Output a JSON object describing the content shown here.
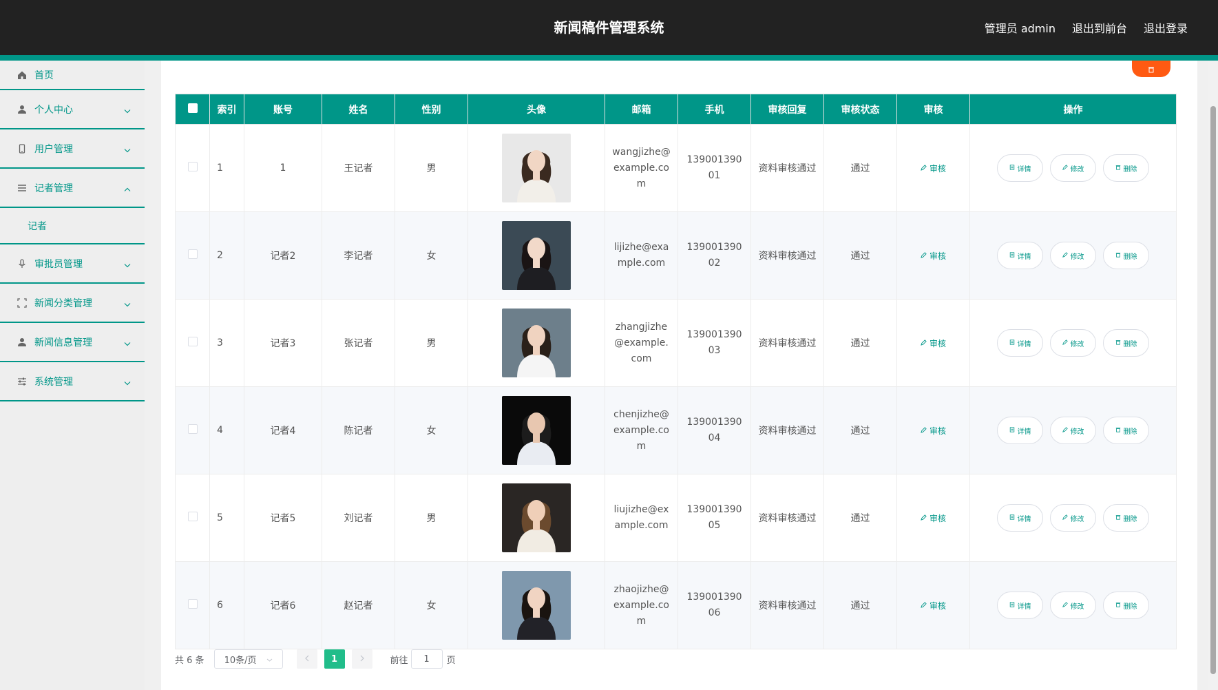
{
  "header": {
    "title": "新闻稿件管理系统",
    "admin_label": "管理员 admin",
    "exit_front": "退出到前台",
    "logout": "退出登录"
  },
  "sidebar": {
    "home": "首页",
    "personal": "个人中心",
    "users": "用户管理",
    "reporters": "记者管理",
    "reporters_sub": "记者",
    "approvers": "审批员管理",
    "news_category": "新闻分类管理",
    "news_info": "新闻信息管理",
    "system": "系统管理"
  },
  "table": {
    "headers": {
      "index": "索引",
      "account": "账号",
      "name": "姓名",
      "gender": "性别",
      "avatar": "头像",
      "email": "邮箱",
      "phone": "手机",
      "review_reply": "审核回复",
      "review_status": "审核状态",
      "review": "审核",
      "actions": "操作"
    },
    "review_action": "审核",
    "detail_label": "详情",
    "edit_label": "修改",
    "delete_label": "删除",
    "rows": [
      {
        "index": "1",
        "account": "1",
        "name": "王记者",
        "gender": "男",
        "email": "wangjizhe@example.com",
        "phone": "13900139001",
        "review_reply": "资料审核通过",
        "review_status": "通过"
      },
      {
        "index": "2",
        "account": "记者2",
        "name": "李记者",
        "gender": "女",
        "email": "lijizhe@example.com",
        "phone": "13900139002",
        "review_reply": "资料审核通过",
        "review_status": "通过"
      },
      {
        "index": "3",
        "account": "记者3",
        "name": "张记者",
        "gender": "男",
        "email": "zhangjizhe@example.com",
        "phone": "13900139003",
        "review_reply": "资料审核通过",
        "review_status": "通过"
      },
      {
        "index": "4",
        "account": "记者4",
        "name": "陈记者",
        "gender": "女",
        "email": "chenjizhe@example.com",
        "phone": "13900139004",
        "review_reply": "资料审核通过",
        "review_status": "通过"
      },
      {
        "index": "5",
        "account": "记者5",
        "name": "刘记者",
        "gender": "男",
        "email": "liujizhe@example.com",
        "phone": "13900139005",
        "review_reply": "资料审核通过",
        "review_status": "通过"
      },
      {
        "index": "6",
        "account": "记者6",
        "name": "赵记者",
        "gender": "女",
        "email": "zhaojizhe@example.com",
        "phone": "13900139006",
        "review_reply": "资料审核通过",
        "review_status": "通过"
      }
    ]
  },
  "pagination": {
    "total": "共 6 条",
    "page_size": "10条/页",
    "current": "1",
    "goto_prefix": "前往",
    "goto_value": "1",
    "goto_suffix": "页"
  },
  "colors": {
    "header_bg": "#222222",
    "accent": "#009688",
    "danger": "#ff5a12",
    "pager_active": "#21bd8a"
  }
}
